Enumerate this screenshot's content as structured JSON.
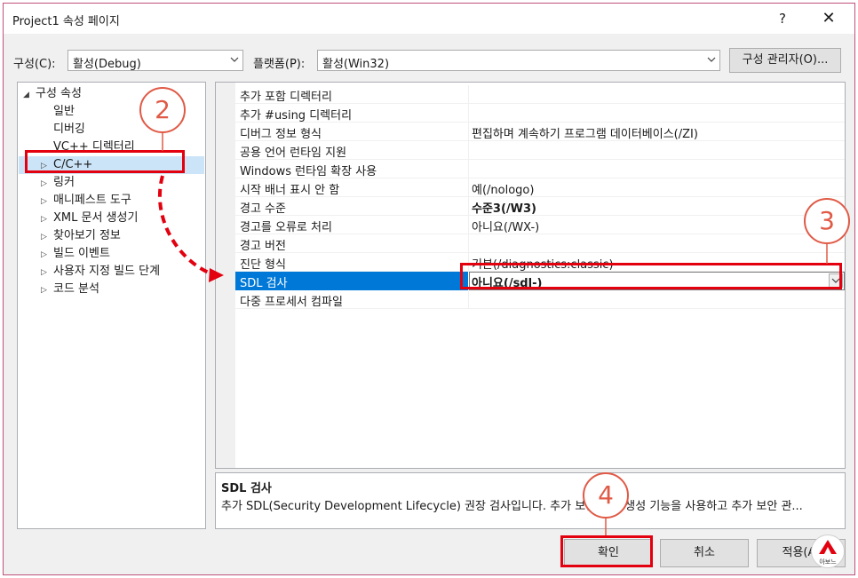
{
  "window": {
    "title": "Project1 속성 페이지",
    "help_label": "?",
    "close_label": "✕"
  },
  "config": {
    "label": "구성(C):",
    "value": "활성(Debug)",
    "platform_label": "플랫폼(P):",
    "platform_value": "활성(Win32)",
    "manager_button": "구성 관리자(O)..."
  },
  "tree": {
    "root": "구성 속성",
    "root_expander": "◢",
    "collapsed_expander": "▷",
    "items": [
      {
        "label": "일반"
      },
      {
        "label": "디버깅"
      },
      {
        "label": "VC++ 디렉터리"
      },
      {
        "label": "C/C++"
      },
      {
        "label": "링커"
      },
      {
        "label": "매니페스트 도구"
      },
      {
        "label": "XML 문서 생성기"
      },
      {
        "label": "찾아보기 정보"
      },
      {
        "label": "빌드 이벤트"
      },
      {
        "label": "사용자 지정 빌드 단계"
      },
      {
        "label": "코드 분석"
      }
    ]
  },
  "properties": [
    {
      "name": "추가 포함 디렉터리",
      "value": ""
    },
    {
      "name": "추가 #using 디렉터리",
      "value": ""
    },
    {
      "name": "디버그 정보 형식",
      "value": "편집하며 계속하기 프로그램 데이터베이스(/ZI)"
    },
    {
      "name": "공용 언어 런타임 지원",
      "value": ""
    },
    {
      "name": "Windows 런타임 확장 사용",
      "value": ""
    },
    {
      "name": "시작 배너 표시 안 함",
      "value": "예(/nologo)"
    },
    {
      "name": "경고 수준",
      "value": "수준3(/W3)"
    },
    {
      "name": "경고를 오류로 처리",
      "value": "아니요(/WX-)"
    },
    {
      "name": "경고 버전",
      "value": ""
    },
    {
      "name": "진단 형식",
      "value": "기본(/diagnostics:classic)"
    },
    {
      "name": "SDL 검사",
      "value": "아니요(/sdl-)"
    },
    {
      "name": "다중 프로세서 컴파일",
      "value": ""
    }
  ],
  "description": {
    "title": "SDL 검사",
    "text": "추가 SDL(Security Development Lifecycle) 권장 검사입니다. 추가 보안 코드 생성 기능을 사용하고 추가 보안 관..."
  },
  "buttons": {
    "ok": "확인",
    "cancel": "취소",
    "apply": "적용(A)"
  },
  "annotations": {
    "step2": "2",
    "step3": "3",
    "step4": "4",
    "accent": "#e3000f"
  },
  "watermark": {
    "text": "아보느"
  }
}
